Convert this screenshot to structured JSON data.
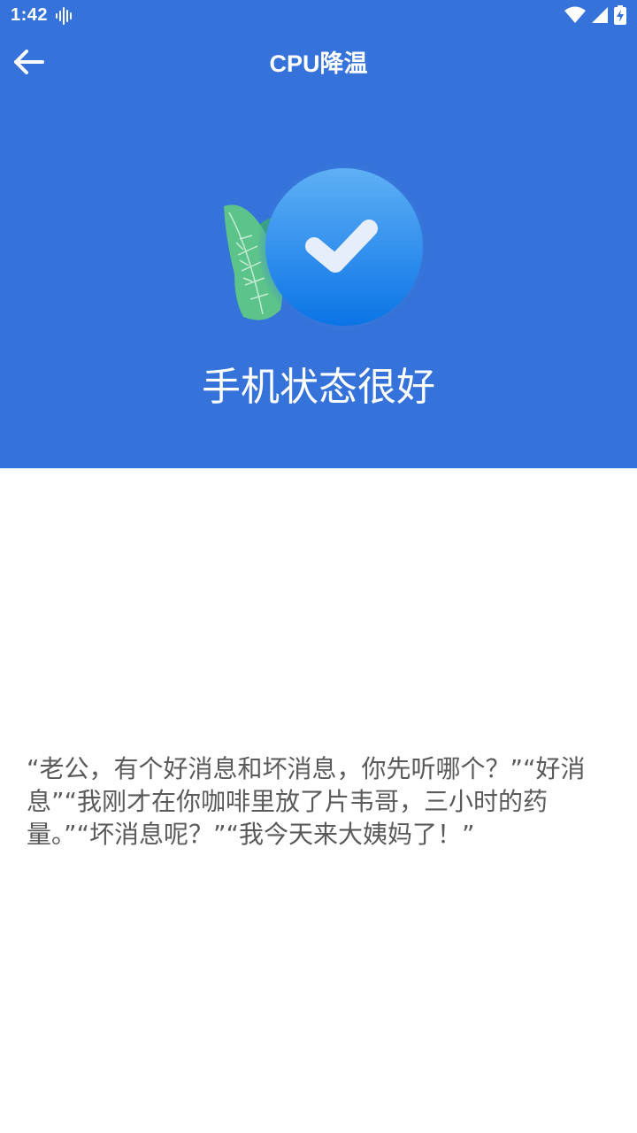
{
  "status_bar": {
    "time": "1:42",
    "icons": [
      "audio-wave-icon",
      "wifi-icon",
      "signal-icon",
      "battery-charging-icon"
    ]
  },
  "toolbar": {
    "title": "CPU降温",
    "back_icon": "arrow-left-icon"
  },
  "result": {
    "illustration": "leaf-check-icon",
    "status_text": "手机状态很好"
  },
  "content": {
    "joke": "“老公，有个好消息和坏消息，你先听哪个？”“好消息”“我刚才在你咖啡里放了片韦哥，三小时的药量。”“坏消息呢？”“我今天来大姨妈了！”"
  },
  "colors": {
    "header_bg": "#3572d9",
    "leaf": "#5cc48a",
    "check_circle": "#2b8cf0",
    "text_gray": "#5a5a5a"
  }
}
